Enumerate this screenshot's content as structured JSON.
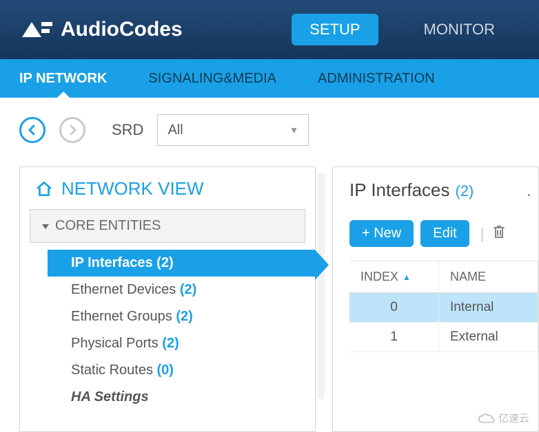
{
  "brand": {
    "name": "AudioCodes"
  },
  "mode_tabs": {
    "setup": "SETUP",
    "monitor": "MONITOR",
    "active": "setup"
  },
  "subnav": {
    "ip_network": "IP NETWORK",
    "signaling_media": "SIGNALING&MEDIA",
    "administration": "ADMINISTRATION",
    "active": "ip_network"
  },
  "toolbar": {
    "srd_label": "SRD",
    "srd_value": "All"
  },
  "sidebar": {
    "network_view": "NETWORK VIEW",
    "group": "CORE ENTITIES",
    "items": [
      {
        "label": "IP Interfaces",
        "count": "(2)",
        "selected": true
      },
      {
        "label": "Ethernet Devices",
        "count": "(2)"
      },
      {
        "label": "Ethernet Groups",
        "count": "(2)"
      },
      {
        "label": "Physical Ports",
        "count": "(2)"
      },
      {
        "label": "Static Routes",
        "count": "(0)"
      },
      {
        "label": "HA Settings",
        "italic": true
      }
    ]
  },
  "main": {
    "title": "IP Interfaces",
    "count": "(2)",
    "actions": {
      "new": "+ New",
      "edit": "Edit"
    },
    "columns": {
      "index": "INDEX",
      "name": "NAME"
    },
    "rows": [
      {
        "index": "0",
        "name": "Internal",
        "selected": true
      },
      {
        "index": "1",
        "name": "External"
      }
    ]
  },
  "watermark": "亿速云"
}
